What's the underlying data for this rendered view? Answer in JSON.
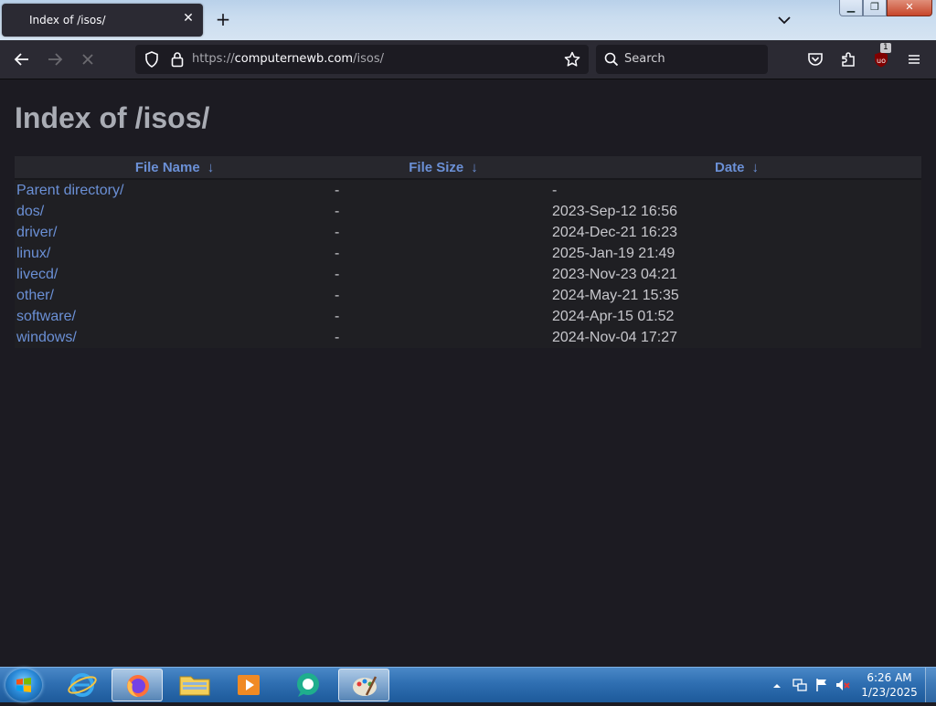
{
  "browser": {
    "tab": {
      "title": "Index of /isos/"
    },
    "new_tab_label": "+",
    "url": {
      "scheme": "https://",
      "host": "computernewb.com",
      "path": "/isos/"
    },
    "search_placeholder": "Search",
    "extension_badge": "1"
  },
  "page": {
    "title": "Index of /isos/",
    "columns": [
      {
        "label": "File Name",
        "sort_arrow": "↓"
      },
      {
        "label": "File Size",
        "sort_arrow": "↓"
      },
      {
        "label": "Date",
        "sort_arrow": "↓"
      }
    ],
    "rows": [
      {
        "name": "Parent directory/",
        "size": "-",
        "date": "-"
      },
      {
        "name": "dos/",
        "size": "-",
        "date": "2023-Sep-12 16:56"
      },
      {
        "name": "driver/",
        "size": "-",
        "date": "2024-Dec-21 16:23"
      },
      {
        "name": "linux/",
        "size": "-",
        "date": "2025-Jan-19 21:49"
      },
      {
        "name": "livecd/",
        "size": "-",
        "date": "2023-Nov-23 04:21"
      },
      {
        "name": "other/",
        "size": "-",
        "date": "2024-May-21 15:35"
      },
      {
        "name": "software/",
        "size": "-",
        "date": "2024-Apr-15 01:52"
      },
      {
        "name": "windows/",
        "size": "-",
        "date": "2024-Nov-04 17:27"
      }
    ]
  },
  "taskbar": {
    "clock_time": "6:26 AM",
    "clock_date": "1/23/2025",
    "icons": [
      "internet-explorer-icon",
      "firefox-icon",
      "file-explorer-icon",
      "media-player-icon",
      "chat-icon",
      "paint-icon"
    ]
  },
  "colors": {
    "link": "#6b90d6",
    "page_bg": "#1c1b22",
    "toolbar_bg": "#2b2a33"
  }
}
